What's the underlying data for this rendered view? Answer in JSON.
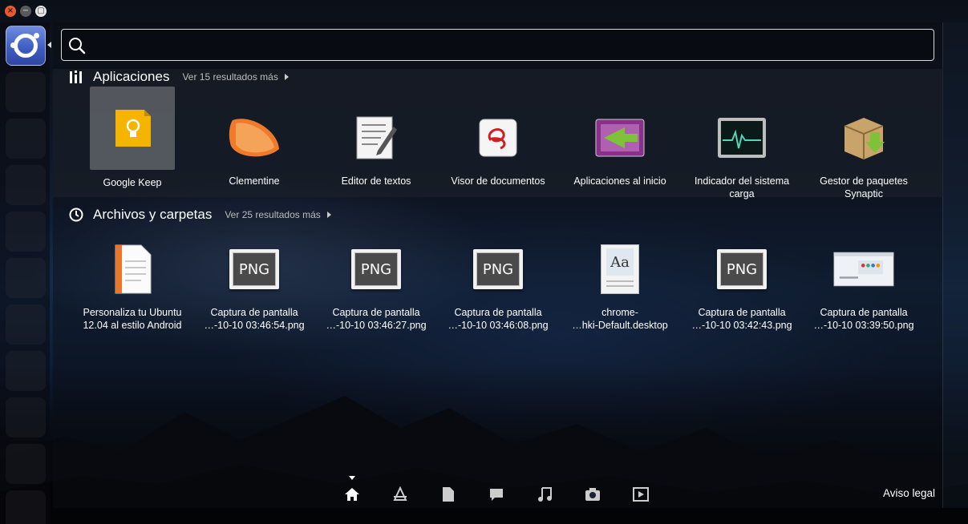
{
  "window_controls": {
    "close": "×",
    "minimize": "−",
    "maximize": "▢"
  },
  "search": {
    "value": "",
    "placeholder": ""
  },
  "applications": {
    "title": "Aplicaciones",
    "more": "Ver 15 resultados más",
    "items": [
      {
        "label": "Google Keep",
        "icon": "google-keep-icon"
      },
      {
        "label": "Clementine",
        "icon": "clementine-icon"
      },
      {
        "label": "Editor de textos",
        "icon": "text-editor-icon"
      },
      {
        "label": "Visor de documentos",
        "icon": "document-viewer-icon"
      },
      {
        "label": "Aplicaciones al inicio",
        "icon": "startup-apps-icon"
      },
      {
        "label": "Indicador del sistema\ncarga",
        "icon": "system-load-icon"
      },
      {
        "label": "Gestor de paquetes\nSynaptic",
        "icon": "synaptic-icon"
      }
    ]
  },
  "files": {
    "title": "Archivos y carpetas",
    "more": "Ver 25 resultados más",
    "items": [
      {
        "label": "Personaliza tu Ubuntu\n12.04 al estilo Android",
        "icon": "document-icon"
      },
      {
        "label": "Captura de pantalla\n…-10-10 03:46:54.png",
        "icon": "png-icon",
        "badge": "PNG"
      },
      {
        "label": "Captura de pantalla\n…-10-10 03:46:27.png",
        "icon": "png-icon",
        "badge": "PNG"
      },
      {
        "label": "Captura de pantalla\n…-10-10 03:46:08.png",
        "icon": "png-icon",
        "badge": "PNG"
      },
      {
        "label": "chrome-\n…hki-Default.desktop",
        "icon": "font-file-icon",
        "badge": "Aa"
      },
      {
        "label": "Captura de pantalla\n…-10-10 03:42:43.png",
        "icon": "png-icon",
        "badge": "PNG"
      },
      {
        "label": "Captura de pantalla\n…-10-10 03:39:50.png",
        "icon": "screenshot-thumbnail-icon"
      }
    ]
  },
  "lenses": [
    "home-lens-icon",
    "applications-lens-icon",
    "files-lens-icon",
    "social-lens-icon",
    "music-lens-icon",
    "photos-lens-icon",
    "video-lens-icon"
  ],
  "legal": "Aviso legal",
  "colors": {
    "accent": "#3d5bbf",
    "keep": "#f4b400",
    "clementine": "#f07a2a"
  }
}
